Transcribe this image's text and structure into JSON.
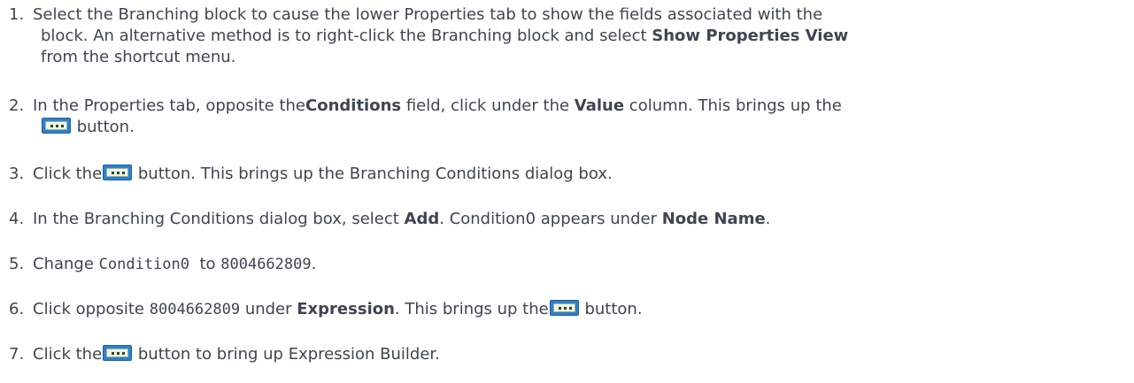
{
  "steps": [
    {
      "num": "1.",
      "line1": "Select the Branching block to cause the lower Properties tab to show the fields associated with the",
      "line2": "block. An alternative method is to right-click the Branching block and select ",
      "line2_bold": "Show Properties View",
      "line3": "from the shortcut menu."
    },
    {
      "num": "2.",
      "t1": "In the Properties tab, opposite the",
      "b1": "Conditions",
      "t2": " field, click under the ",
      "b2": "Value",
      "t3": " column. This brings up the",
      "t4": " button."
    },
    {
      "num": "3.",
      "t1": "Click the",
      "t2": " button. This brings up the Branching Conditions dialog box."
    },
    {
      "num": "4.",
      "t1": "In the Branching Conditions dialog box, select ",
      "b1": "Add",
      "t2": ". Condition0 appears under ",
      "b2": "Node Name",
      "t3": "."
    },
    {
      "num": "5.",
      "t1": "Change ",
      "m1": "Condition0",
      "t2": "  to ",
      "m2": "8004662809",
      "t3": "."
    },
    {
      "num": "6.",
      "t1": "Click opposite ",
      "m1": "8004662809",
      "t2": " under ",
      "b1": "Expression",
      "t3": ". This brings up the",
      "t4": " button."
    },
    {
      "num": "7.",
      "t1": "Click the",
      "t2": " button to bring up Expression Builder."
    }
  ],
  "icons": {
    "ellipsis_button": "ellipsis-button-icon",
    "fill_color": "#2f7fcf"
  }
}
